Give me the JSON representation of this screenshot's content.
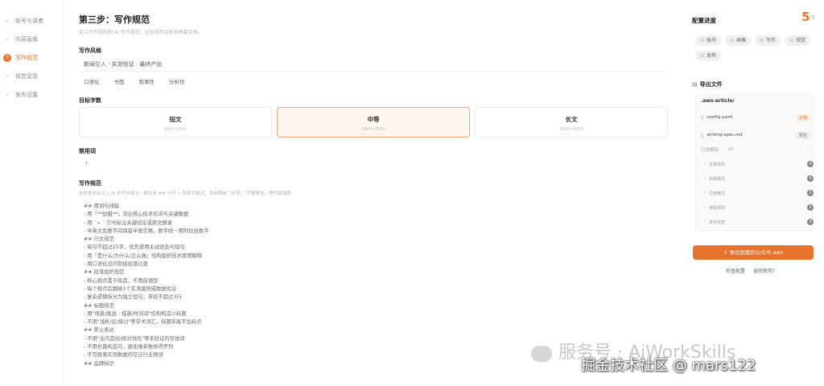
{
  "sidebar": {
    "items": [
      {
        "label": "账号与读者",
        "icon": "check-icon",
        "active": false
      },
      {
        "label": "内容画像",
        "icon": "check-icon",
        "active": false
      },
      {
        "label": "写作规范",
        "icon": "3",
        "active": true
      },
      {
        "label": "视觉呈现",
        "icon": "check-icon",
        "active": false
      },
      {
        "label": "发布设置",
        "icon": "check-icon",
        "active": false
      }
    ]
  },
  "main": {
    "title": "第三步：写作规范",
    "subtitle": "定义写作规则和 AI 写作规范，这些规则会影响每篇文章。",
    "style_section": "写作风格",
    "style_value": "新闻引入 · 实测验证 · 最终产出",
    "style_chips": [
      "口语化",
      "书面",
      "叙事性",
      "分析性"
    ],
    "length_section": "目标字数",
    "length_cards": [
      {
        "title": "短文",
        "range": "800-1200",
        "selected": false
      },
      {
        "title": "中等",
        "range": "1800-2500",
        "selected": true
      },
      {
        "title": "长文",
        "range": "3000-4000",
        "selected": false
      }
    ],
    "banned_section": "禁用词",
    "banned_add": "+",
    "spec_section": "写作规范",
    "spec_desc": "这些规则会注入 AI 的写作指令，建议用 ## 分节 + 短条目格式，并标明是「必须」「尽量避免」等约束强度。",
    "spec_lines": [
      "## 用词与排版",
      "- 用「**加粗**」突出核心技术名词与关键数据",
      "- 用 `> ` 引号标注关键结论或原文摘录",
      "- 中英文及数字间保留半角空格，数字统一用阿拉伯数字",
      "## 行文规范",
      "- 每句不超过25字，优先使用主动语态与短句",
      "- 用「是什么/为什么/怎么做」结构组织技术原理解释",
      "- 用口语化设问衔接段落过渡",
      "## 段落组织规范",
      "- 核心观点置于段首，不用前铺垫",
      "- 每个观点后跟随1个实测案例或数据佐证",
      "- 复杂逻辑拆分为独立短句，单段不超过3行",
      "## 标题规范",
      "- 用\"场景/挑战 - 措施/时间词\"结构构造小标题",
      "- 不用\"浅析/论/探讨\"等学术词汇，标题末尾不加标点",
      "## 禁止表达",
      "- 不用\"业内首创/绝对领先\"等未验证的夸张词",
      "- 不用长篇构造句，避免堆参数排得罗列",
      "- 不写脱离实测数据的空泛行业预测",
      "## 品牌标识"
    ]
  },
  "right": {
    "progress_title": "配置进度",
    "progress_value": "5",
    "progress_total": "/5",
    "progress_tags": [
      "账号",
      "画像",
      "写作",
      "视觉",
      "发布"
    ],
    "export_title": "导出文件",
    "folder": ".aws-article/",
    "files": [
      {
        "name": "config.yaml",
        "action": "必填"
      },
      {
        "name": "writing-spec.md",
        "action": "预览"
      }
    ],
    "version_label": "已选模板：",
    "version_value": "15",
    "sub_items": [
      {
        "label": "文章结构",
        "count": "4"
      },
      {
        "label": "标题格式",
        "count": "4"
      },
      {
        "label": "引用格式",
        "count": "3"
      },
      {
        "label": "排版规则",
        "count": "3"
      },
      {
        "label": "发布检查",
        "count": "3"
      }
    ],
    "export_button": "导出到我的公众号.aws",
    "links": [
      "检查配置",
      "返回使用?"
    ]
  },
  "watermark": {
    "text": "服务号 · AiWorkSkills",
    "credit": "掘金技术社区 @ mars122"
  },
  "colors": {
    "accent": "#e8732c",
    "accent_light": "#fff6ef",
    "border": "#ececec"
  }
}
